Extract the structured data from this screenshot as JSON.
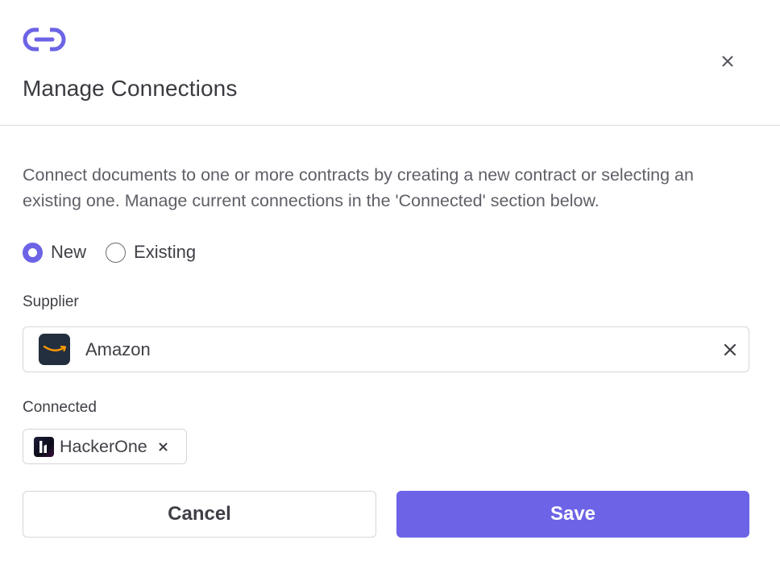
{
  "header": {
    "title": "Manage Connections",
    "icon": "link-icon",
    "close_icon": "close-icon"
  },
  "description": "Connect documents to one or more contracts by creating a new contract or selecting an existing one. Manage current connections in the 'Connected' section below.",
  "mode": {
    "selected": "New",
    "options": [
      {
        "label": "New",
        "checked": true
      },
      {
        "label": "Existing",
        "checked": false
      }
    ]
  },
  "supplier": {
    "label": "Supplier",
    "value": "Amazon",
    "logo_icon": "amazon-logo-icon",
    "clear_icon": "clear-icon"
  },
  "connected": {
    "label": "Connected",
    "items": [
      {
        "label": "HackerOne",
        "logo_icon": "hackerone-logo-icon",
        "remove_icon": "remove-icon"
      }
    ]
  },
  "actions": {
    "cancel_label": "Cancel",
    "save_label": "Save"
  },
  "colors": {
    "accent": "#6c63e6",
    "text": "#3f3f46",
    "border": "#d6d6da"
  }
}
